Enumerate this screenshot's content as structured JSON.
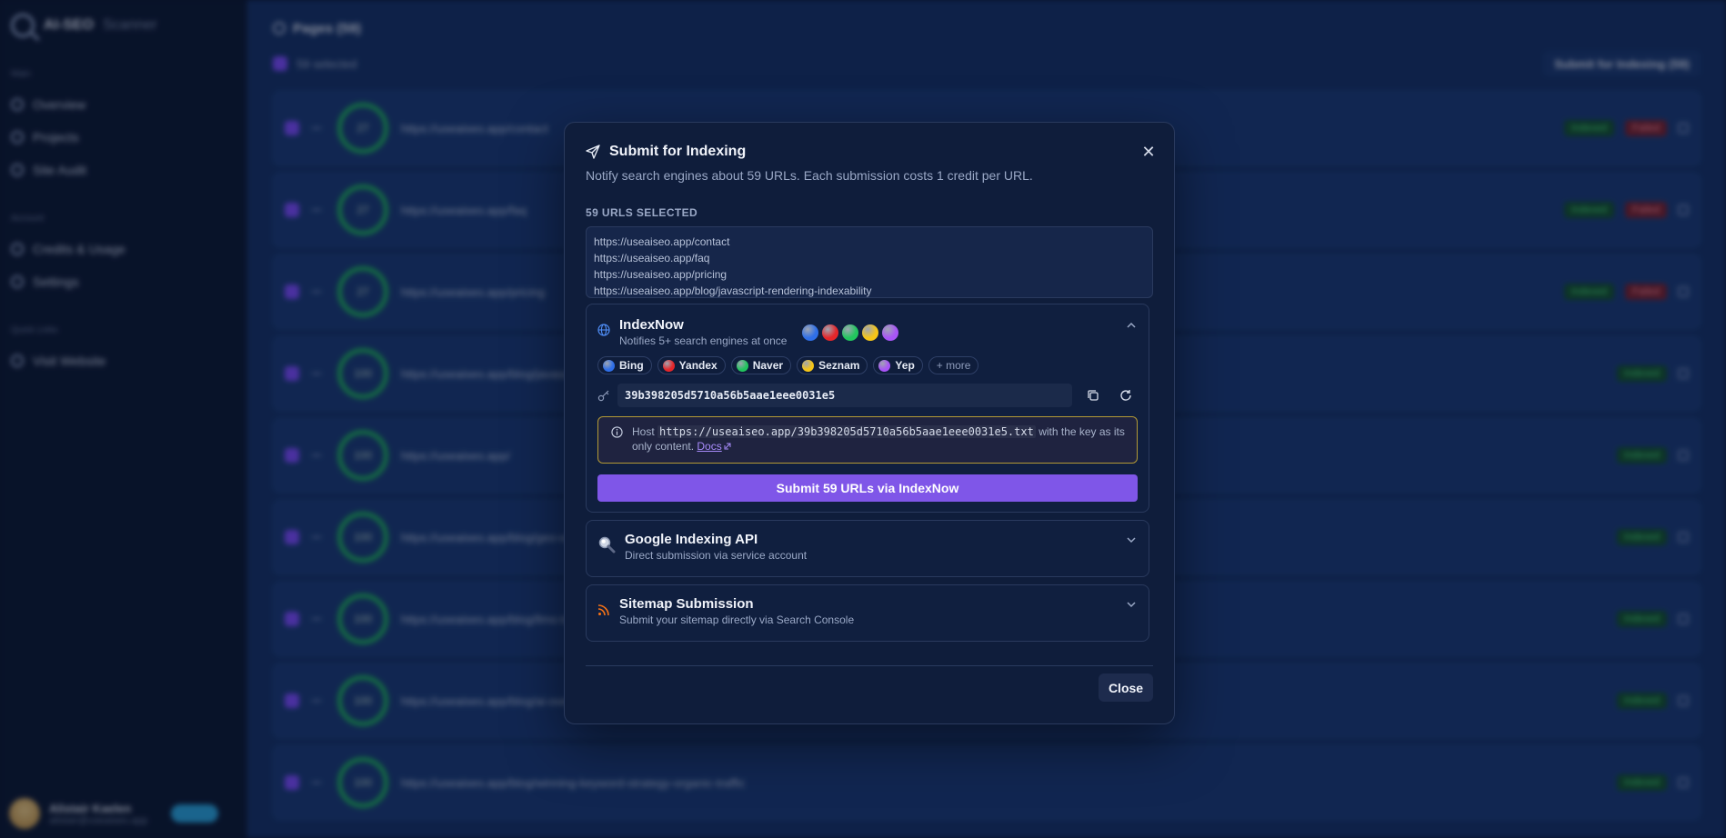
{
  "background": {
    "brand": {
      "name": "AI-SEO",
      "suffix": "Scanner"
    },
    "nav": {
      "section_main": "Main",
      "items_main": [
        {
          "label": "Overview",
          "icon": "grid-icon"
        },
        {
          "label": "Projects",
          "icon": "folder-icon"
        },
        {
          "label": "Site Audit",
          "icon": "search-icon"
        }
      ],
      "section_account": "Account",
      "items_account": [
        {
          "label": "Credits & Usage",
          "icon": "credit-icon"
        },
        {
          "label": "Settings",
          "icon": "gear-icon"
        }
      ],
      "section_quick": "Quick Links",
      "items_quick": [
        {
          "label": "Visit Website",
          "icon": "external-icon"
        }
      ]
    },
    "user": {
      "name": "Alistair Kaelen",
      "email": "alistair@useaiseo.app"
    },
    "header": {
      "title": "Pages (59)",
      "selected": "59 selected",
      "submit_button": "Submit for Indexing (59)"
    },
    "rows": [
      {
        "score": "27",
        "url": "https://useaiseo.app/contact",
        "status": "Indexed",
        "flag": "Failed"
      },
      {
        "score": "27",
        "url": "https://useaiseo.app/faq",
        "status": "Indexed",
        "flag": "Failed"
      },
      {
        "score": "27",
        "url": "https://useaiseo.app/pricing",
        "status": "Indexed",
        "flag": "Failed"
      },
      {
        "score": "100",
        "url": "https://useaiseo.app/blog/javascript-rendering-indexability",
        "status": "Indexed",
        "flag": ""
      },
      {
        "score": "100",
        "url": "https://useaiseo.app/",
        "status": "Indexed",
        "flag": ""
      },
      {
        "score": "100",
        "url": "https://useaiseo.app/blog/geo-vs-seo",
        "status": "Indexed",
        "flag": ""
      },
      {
        "score": "100",
        "url": "https://useaiseo.app/blog/llms-txt-guide",
        "status": "Indexed",
        "flag": ""
      },
      {
        "score": "100",
        "url": "https://useaiseo.app/blog/ai-overviews",
        "status": "Indexed",
        "flag": ""
      },
      {
        "score": "100",
        "url": "https://useaiseo.app/blog/winning-keyword-strategy-organic-traffic",
        "status": "Indexed",
        "flag": ""
      }
    ]
  },
  "modal": {
    "title": "Submit for Indexing",
    "description": "Notify search engines about 59 URLs. Each submission costs 1 credit per URL.",
    "urls_label": "59 URLS SELECTED",
    "urls": [
      "https://useaiseo.app/contact",
      "https://useaiseo.app/faq",
      "https://useaiseo.app/pricing",
      "https://useaiseo.app/blog/javascript-rendering-indexability"
    ],
    "indexnow": {
      "title": "IndexNow",
      "subtitle": "Notifies 5+ search engines at once",
      "dot_colors": [
        "#2f6fe8",
        "#e5262a",
        "#22c55e",
        "#f5c518",
        "#a855f7"
      ],
      "engines": [
        {
          "label": "Bing",
          "color": "#2f6fe8"
        },
        {
          "label": "Yandex",
          "color": "#e5262a"
        },
        {
          "label": "Naver",
          "color": "#22c55e"
        },
        {
          "label": "Seznam",
          "color": "#f5c518"
        },
        {
          "label": "Yep",
          "color": "#a855f7"
        }
      ],
      "more_label": "+ more",
      "api_key": "39b398205d5710a56b5aae1eee0031e5",
      "note_prefix": "Host",
      "note_code": "https://useaiseo.app/39b398205d5710a56b5aae1eee0031e5.txt",
      "note_suffix": "with the key as its only content.",
      "docs_label": "Docs",
      "submit_label": "Submit 59 URLs via IndexNow"
    },
    "google": {
      "title": "Google Indexing API",
      "subtitle": "Direct submission via service account"
    },
    "sitemap": {
      "title": "Sitemap Submission",
      "subtitle": "Submit your sitemap directly via Search Console"
    },
    "close_label": "Close"
  }
}
